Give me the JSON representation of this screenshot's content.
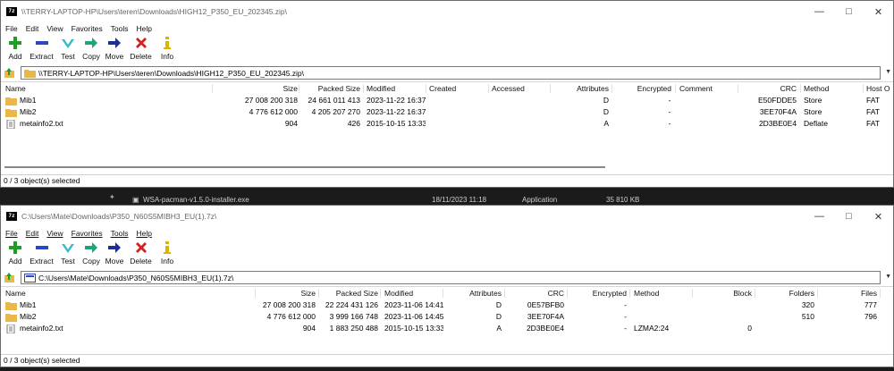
{
  "colors": {
    "folder": "#e8b84a",
    "add": "#1f9d23",
    "extract": "#2b47c8",
    "test": "#36b9c9",
    "move": "#1b2e9a",
    "delete": "#d62020",
    "info": "#d9b400"
  },
  "window1": {
    "title": "\\\\TERRY-LAPTOP-HP\\Users\\teren\\Downloads\\HIGH12_P350_EU_202345.zip\\",
    "menu": [
      "File",
      "Edit",
      "View",
      "Favorites",
      "Tools",
      "Help"
    ],
    "toolbar": [
      "Add",
      "Extract",
      "Test",
      "Copy",
      "Move",
      "Delete",
      "Info"
    ],
    "address": "\\\\TERRY-LAPTOP-HP\\Users\\teren\\Downloads\\HIGH12_P350_EU_202345.zip\\",
    "columns": [
      "Name",
      "Size",
      "Packed Size",
      "Modified",
      "Created",
      "Accessed",
      "Attributes",
      "Encrypted",
      "Comment",
      "CRC",
      "Method",
      "Host O"
    ],
    "rows": [
      {
        "name": "Mib1",
        "size": "27 008 200 318",
        "packed": "24 661 011 413",
        "modified": "2023-11-22 16:37",
        "attributes": "D",
        "encrypted": "-",
        "crc": "E50FDDE5",
        "method": "Store",
        "host": "FAT"
      },
      {
        "name": "Mib2",
        "size": "4 776 612 000",
        "packed": "4 205 207 270",
        "modified": "2023-11-22 16:37",
        "attributes": "D",
        "encrypted": "-",
        "crc": "3EE70F4A",
        "method": "Store",
        "host": "FAT"
      },
      {
        "name": "metainfo2.txt",
        "size": "904",
        "packed": "426",
        "modified": "2015-10-15 13:33",
        "attributes": "A",
        "encrypted": "-",
        "crc": "2D3BE0E4",
        "method": "Deflate",
        "host": "FAT"
      }
    ],
    "status": "0 / 3 object(s) selected"
  },
  "background": {
    "file": "WSA-pacman-v1.5.0-installer.exe",
    "date": "18/11/2023 11:18",
    "type": "Application",
    "size": "35 810 KB"
  },
  "window2": {
    "title": "C:\\Users\\Mate\\Downloads\\P350_N60S5MIBH3_EU(1).7z\\",
    "menu": [
      "File",
      "Edit",
      "View",
      "Favorites",
      "Tools",
      "Help"
    ],
    "toolbar": [
      "Add",
      "Extract",
      "Test",
      "Copy",
      "Move",
      "Delete",
      "Info"
    ],
    "address": "C:\\Users\\Mate\\Downloads\\P350_N60S5MIBH3_EU(1).7z\\",
    "columns": [
      "Name",
      "Size",
      "Packed Size",
      "Modified",
      "Attributes",
      "CRC",
      "Encrypted",
      "Method",
      "Block",
      "Folders",
      "Files"
    ],
    "rows": [
      {
        "name": "Mib1",
        "size": "27 008 200 318",
        "packed": "22 224 431 126",
        "modified": "2023-11-06 14:41",
        "attributes": "D",
        "crc": "0E57BFB0",
        "encrypted": "-",
        "method": "",
        "block": "",
        "folders": "320",
        "files": "777"
      },
      {
        "name": "Mib2",
        "size": "4 776 612 000",
        "packed": "3 999 166 748",
        "modified": "2023-11-06 14:45",
        "attributes": "D",
        "crc": "3EE70F4A",
        "encrypted": "-",
        "method": "",
        "block": "",
        "folders": "510",
        "files": "796"
      },
      {
        "name": "metainfo2.txt",
        "size": "904",
        "packed": "1 883 250 488",
        "modified": "2015-10-15 13:33",
        "attributes": "A",
        "crc": "2D3BE0E4",
        "encrypted": "-",
        "method": "LZMA2:24",
        "block": "0",
        "folders": "",
        "files": ""
      }
    ],
    "status": "0 / 3 object(s) selected"
  }
}
